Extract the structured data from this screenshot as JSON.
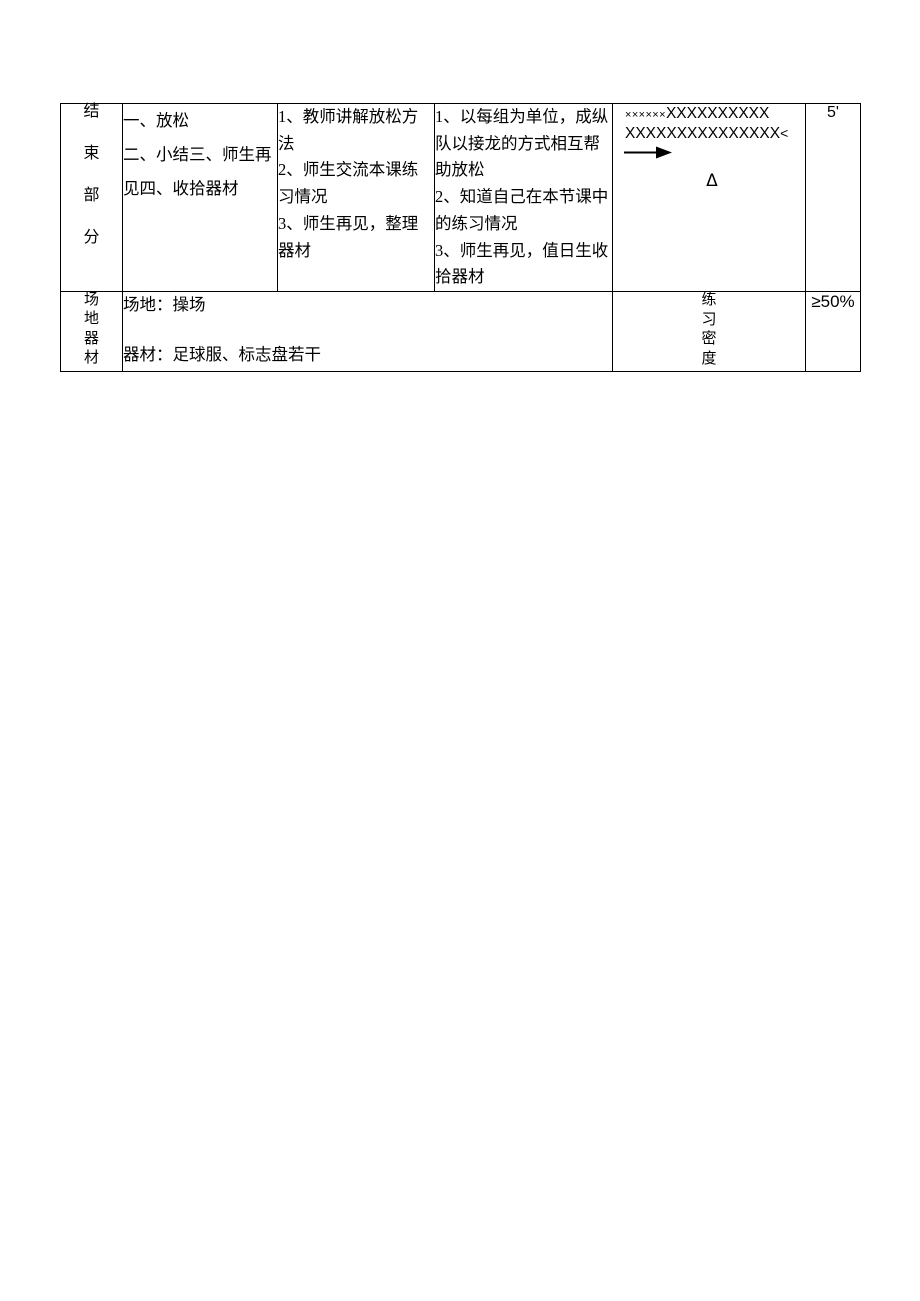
{
  "document": {
    "type": "lesson-plan-table-fragment"
  },
  "table": {
    "closing_row": {
      "stage_label": "结束部分",
      "content_lines": [
        "一、放松",
        "二、小结三、师生再",
        "见四、收拾器材"
      ],
      "teacher_lines": [
        "1、教师讲解放松方",
        "法",
        "2、师生交流本课练",
        "习情况",
        "3、师生再见，整理",
        "器材"
      ],
      "student_lines": [
        "1、以每组为单位，成纵",
        "队以接龙的方式相互帮",
        "助放松",
        "2、知道自己在本节课中",
        "的练习情况",
        "3、师生再见，值日生收",
        "拾器材"
      ],
      "diagram": {
        "row1_small_x": "××××××",
        "row1_big_x": "XXXXXXXXXX",
        "row2_big_x": "XXXXXXXXXXXXXXX",
        "row2_caret": "<",
        "arrow_icon": "right-arrow",
        "triangle_mark": "Δ"
      },
      "time": "5'"
    },
    "venue_row": {
      "label": "场地器材",
      "venue_line": "场地：操场",
      "equipment_line": "器材：足球服、标志盘若干",
      "density_label": "练习密度",
      "density_value": "≥50%"
    }
  }
}
